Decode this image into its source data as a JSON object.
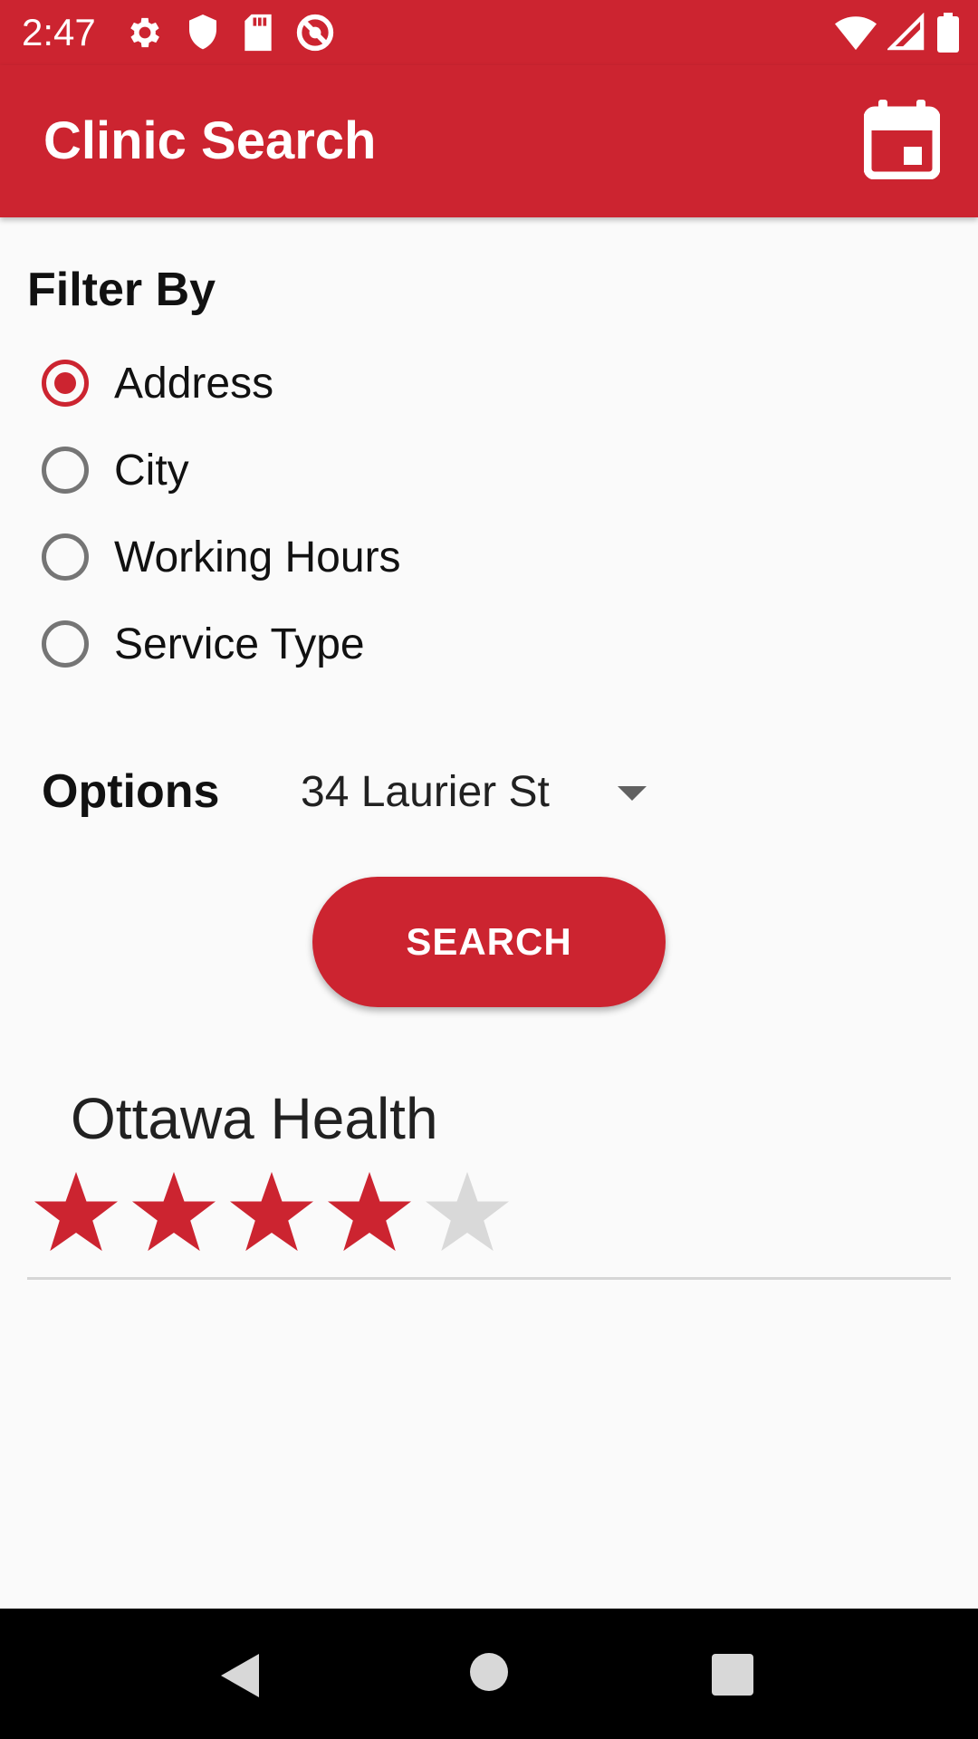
{
  "status_bar": {
    "time": "2:47",
    "left_icons": [
      "gear-icon",
      "shield-icon",
      "sd-card-icon",
      "do-not-disturb-icon"
    ],
    "right_icons": [
      "wifi-icon",
      "cell-signal-icon",
      "battery-icon"
    ]
  },
  "app_bar": {
    "title": "Clinic Search",
    "action_icon": "calendar-icon"
  },
  "filter": {
    "heading": "Filter By",
    "options": [
      {
        "label": "Address",
        "checked": true
      },
      {
        "label": "City",
        "checked": false
      },
      {
        "label": "Working Hours",
        "checked": false
      },
      {
        "label": "Service Type",
        "checked": false
      }
    ]
  },
  "options": {
    "label": "Options",
    "selected_value": "34 Laurier St"
  },
  "search_button": {
    "label": "SEARCH"
  },
  "results": [
    {
      "name": "Ottawa Health",
      "rating": 4,
      "max_rating": 5
    }
  ],
  "colors": {
    "accent": "#cc2430",
    "star_empty": "#d9d9d9"
  },
  "nav_bar": {
    "icons": [
      "back-icon",
      "home-icon",
      "recents-icon"
    ]
  }
}
